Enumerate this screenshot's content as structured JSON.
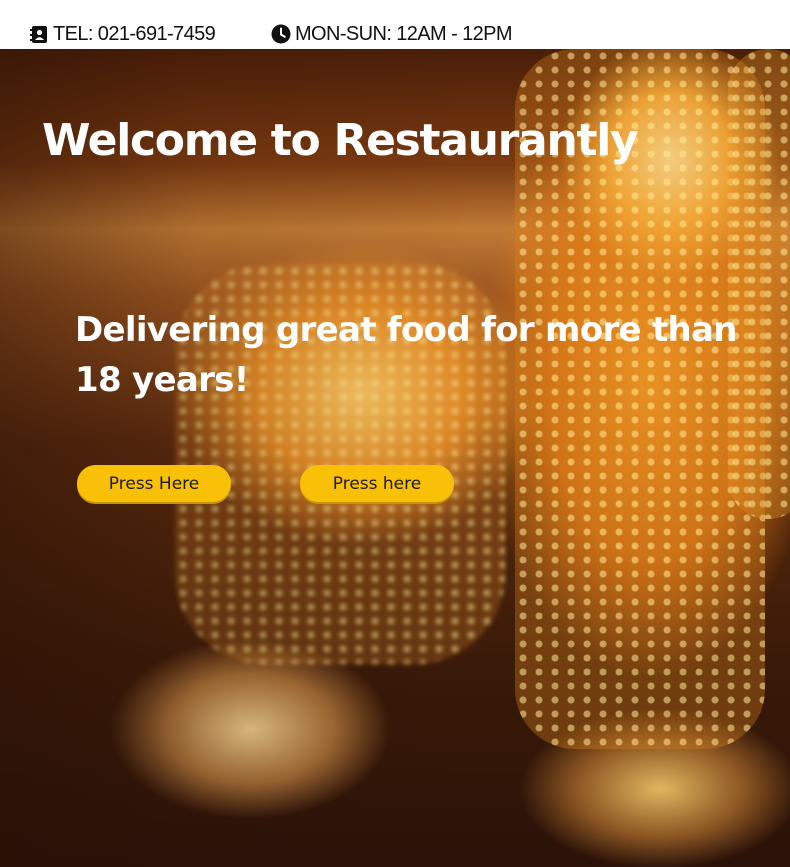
{
  "topbar": {
    "phone_icon": "contact-card-icon",
    "phone_text": "TEL: 021-691-7459",
    "hours_icon": "clock-icon",
    "hours_text": "MON-SUN: 12AM - 12PM"
  },
  "hero": {
    "title": "Welcome to Restaurantly",
    "subtitle": "Delivering great food for more than 18 years!",
    "buttons": [
      {
        "label": "Press Here"
      },
      {
        "label": "Press here"
      }
    ],
    "button_color": "#f9c008",
    "text_color": "#ffffff"
  }
}
